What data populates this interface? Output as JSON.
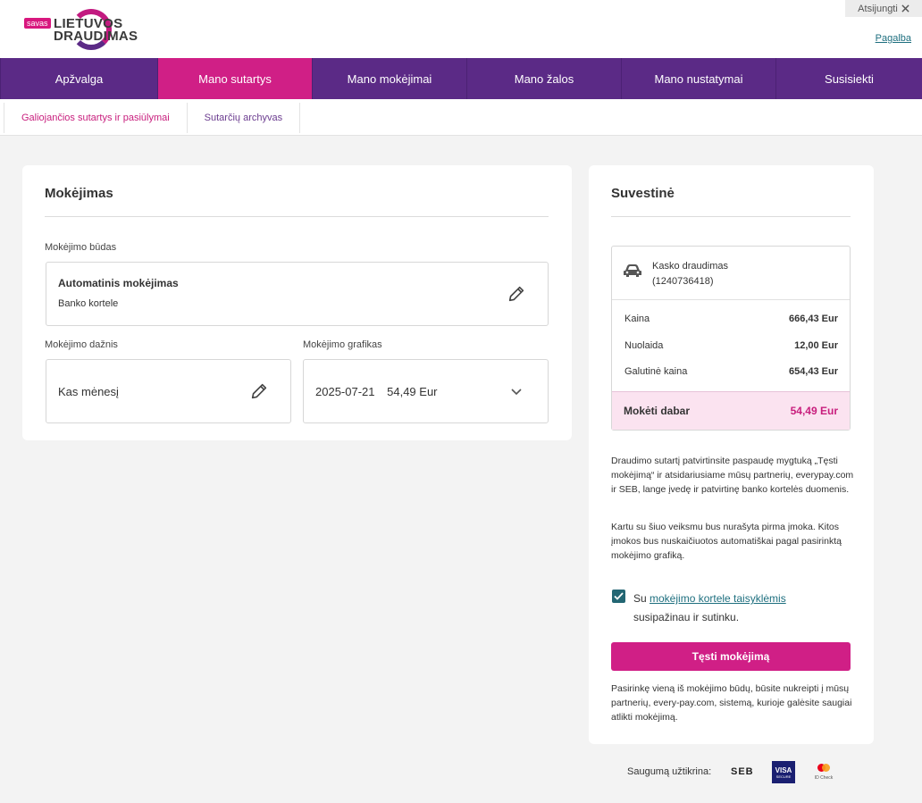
{
  "brand": {
    "badge": "savas",
    "line1": "LIETUVOS",
    "line2": "DRAUDIMAS",
    "primary": "#5b2a86",
    "accent": "#d01f86"
  },
  "header": {
    "logout_label": "Atsijungti",
    "logout_icon": "close-icon",
    "help_label": "Pagalba"
  },
  "nav": [
    {
      "label": "Apžvalga"
    },
    {
      "label": "Mano sutartys"
    },
    {
      "label": "Mano mokėjimai"
    },
    {
      "label": "Mano žalos"
    },
    {
      "label": "Mano nustatymai"
    },
    {
      "label": "Susisiekti"
    }
  ],
  "subnav": [
    {
      "label": "Galiojančios sutartys ir pasiūlymai"
    },
    {
      "label": "Sutarčių archyvas"
    }
  ],
  "payment": {
    "title": "Mokėjimas",
    "method_label": "Mokėjimo būdas",
    "method_title": "Automatinis mokėjimas",
    "method_sub": "Banko kortele",
    "frequency_label": "Mokėjimo dažnis",
    "frequency_value": "Kas mėnesį",
    "schedule_label": "Mokėjimo grafikas",
    "schedule_date": "2025-07-21",
    "schedule_amount": "54,49 Eur"
  },
  "summary": {
    "title": "Suvestinė",
    "product_name": "Kasko draudimas",
    "product_id": "(1240736418)",
    "price_label": "Kaina",
    "price_value": "666,43 Eur",
    "discount_label": "Nuolaida",
    "discount_value": "12,00 Eur",
    "final_label": "Galutinė kaina",
    "final_value": "654,43 Eur",
    "pay_now_label": "Mokėti dabar",
    "pay_now_value": "54,49 Eur",
    "info1": "Draudimo sutartį patvirtinsite paspaudę mygtuką „Tęsti mokėjimą“ ir atsidariusiame mūsų partnerių, everypay.com ir SEB, lange įvedę ir patvirtinę banko kortelės duomenis.",
    "info2": "Kartu su šiuo veiksmu bus nurašyta pirma įmoka. Kitos įmokos bus nuskaičiuotos automatiškai pagal pasirinktą mokėjimo grafiką.",
    "consent_prefix": "Su ",
    "consent_link": "mokėjimo kortele taisyklėmis",
    "consent_suffix": "susipažinau ir sutinku.",
    "consent_checked": true,
    "continue_label": "Tęsti mokėjimą",
    "footnote": "Pasirinkę vieną iš mokėjimo būdų, būsite nukreipti į mūsų partnerių, every-pay.com, sistemą, kurioje galėsite saugiai atlikti mokėjimą."
  },
  "footer": {
    "security_label": "Saugumą užtikrina:",
    "seb": "SEB",
    "visa": "VISA",
    "visa_sub": "SECURE",
    "mc_sub": "ID Check"
  }
}
